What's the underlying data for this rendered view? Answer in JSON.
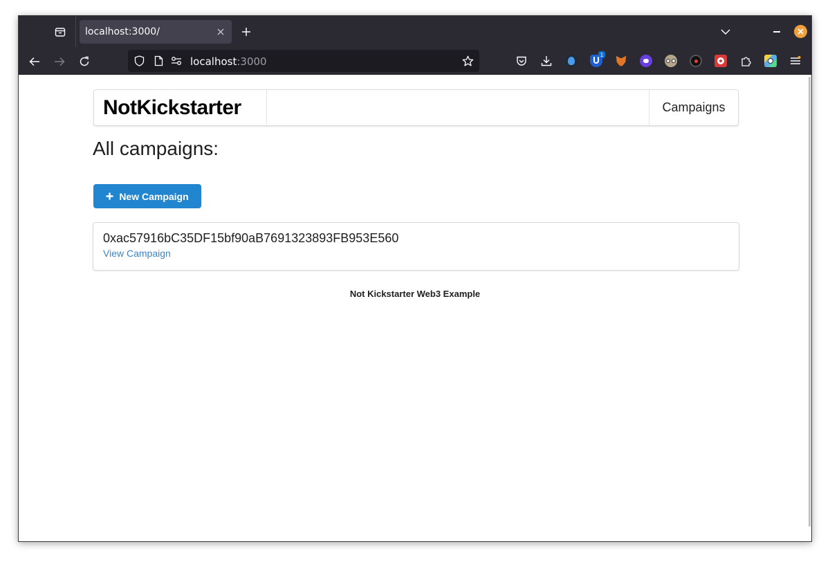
{
  "browser": {
    "tab_title": "localhost:3000/",
    "url_host": "localhost",
    "url_port": ":3000",
    "accent_close": "#f0a03c"
  },
  "icons": {
    "tab_list": "tab-list-icon",
    "close_tab": "close-icon",
    "new_tab": "plus-icon",
    "back": "arrow-left-icon",
    "forward": "arrow-right-icon",
    "reload": "reload-icon",
    "shield": "shield-icon",
    "page": "page-icon",
    "permissions": "permissions-icon",
    "bookmark": "star-icon",
    "pocket": "pocket-icon",
    "downloads": "download-icon",
    "extensions": "puzzle-icon",
    "menu": "hamburger-icon"
  },
  "extensions": {
    "ublock_badge": "1"
  },
  "site": {
    "logo": "NotKickstarter",
    "menu_campaigns": "Campaigns",
    "heading": "All campaigns:",
    "new_campaign_label": "New Campaign",
    "campaigns": [
      {
        "address": "0xac57916bC35DF15bf90aB7691323893FB953E560",
        "link": "View Campaign"
      }
    ],
    "footer": "Not Kickstarter Web3 Example",
    "primary_color": "#2185d0",
    "link_color": "#4183c4"
  }
}
